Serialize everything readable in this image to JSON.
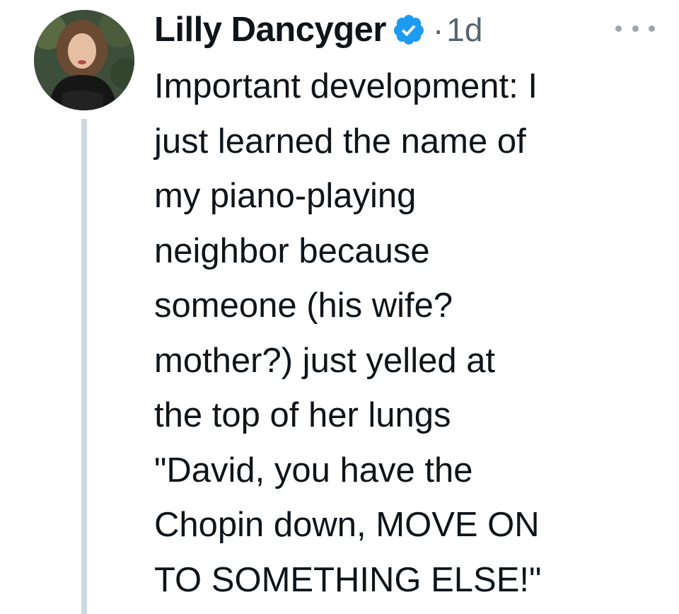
{
  "tweet": {
    "author": {
      "display_name": "Lilly Dancyger",
      "verified": true,
      "avatar_icon": "avatar-photo"
    },
    "separator": "·",
    "timestamp": "1d",
    "more_icon": "more-options-icon",
    "text_lines": [
      "Important development: I",
      "just learned the name of",
      "my piano-playing",
      "neighbor because",
      "someone (his wife?",
      "mother?) just yelled at",
      "the top of her lungs",
      "\"David, you have the",
      "Chopin down, MOVE ON",
      "TO SOMETHING ELSE!\""
    ]
  },
  "colors": {
    "text": "#0f1419",
    "secondary": "#536471",
    "verified_blue": "#1d9bf0",
    "thread_line": "#cfd9de"
  }
}
